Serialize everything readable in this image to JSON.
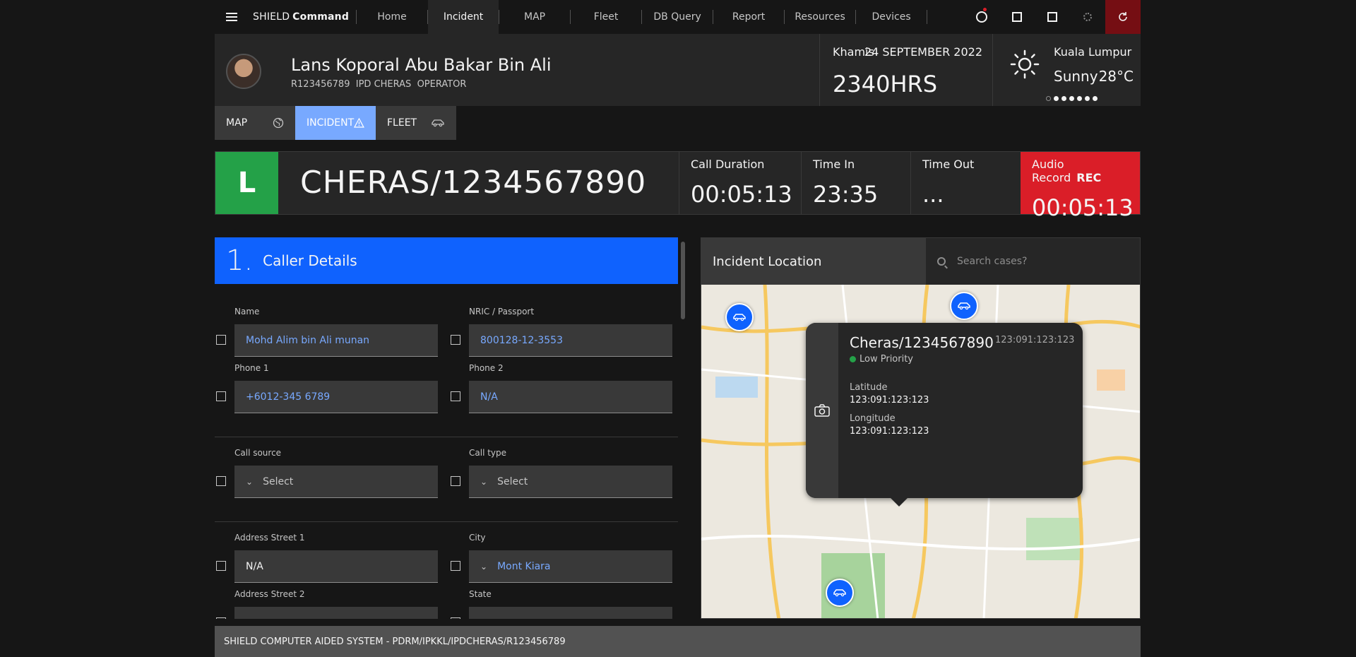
{
  "nav": {
    "brand_main": "SHIELD",
    "brand_bold": "Command",
    "items": [
      {
        "label": "Home"
      },
      {
        "label": "Incident"
      },
      {
        "label": "MAP"
      },
      {
        "label": "Fleet"
      },
      {
        "label": "DB Query"
      },
      {
        "label": "Report"
      },
      {
        "label": "Resources"
      },
      {
        "label": "Devices"
      }
    ],
    "active_item": "Incident",
    "icons": [
      "notification-icon",
      "square-icon",
      "square-icon",
      "settings-icon",
      "refresh-icon"
    ]
  },
  "user": {
    "name": "Lans Koporal Abu Bakar Bin Ali",
    "id": "R123456789",
    "unit": "IPD CHERAS",
    "role": "OPERATOR"
  },
  "datetime": {
    "day": "Khamis",
    "date": "24 SEPTEMBER 2022",
    "time": "2340HRS"
  },
  "weather": {
    "city": "Kuala Lumpur",
    "condition": "Sunny",
    "temp": "28°C"
  },
  "modes": [
    {
      "label": "MAP"
    },
    {
      "label": "INCIDENT"
    },
    {
      "label": "FLEET"
    }
  ],
  "case": {
    "level": "L",
    "id": "CHERAS/1234567890",
    "call_duration_label": "Call Duration",
    "call_duration": "00:05:13",
    "time_in_label": "Time In",
    "time_in": "23:35",
    "time_out_label": "Time Out",
    "time_out": "...",
    "audio_label": "Audio Record",
    "audio_tag": "REC",
    "audio_time": "00:05:13"
  },
  "section": {
    "number": "1.",
    "title": "Caller Details"
  },
  "form": {
    "name_label": "Name",
    "name": "Mohd Alim bin Ali munan",
    "nric_label": "NRIC / Passport",
    "nric": "800128-12-3553",
    "phone1_label": "Phone 1",
    "phone1": "+6012-345 6789",
    "phone2_label": "Phone 2",
    "phone2": "N/A",
    "call_source_label": "Call source",
    "call_source": "Select",
    "call_type_label": "Call type",
    "call_type": "Select",
    "addr1_label": "Address Street 1",
    "addr1": "N/A",
    "city_label": "City",
    "city": "Mont Kiara",
    "addr2_label": "Address Street 2",
    "state_label": "State"
  },
  "map": {
    "title": "Incident Location",
    "search_placeholder": "Search cases?",
    "popup": {
      "title": "Cheras/1234567890",
      "code": "123:091:123:123",
      "priority": "Low Priority",
      "priority_color": "#24a148",
      "lat_label": "Latitude",
      "lat": "123:091:123:123",
      "lon_label": "Longitude",
      "lon": "123:091:123:123"
    }
  },
  "footer": {
    "text": "SHIELD COMPUTER AIDED SYSTEM - PDRM/IPKKL/IPDCHERAS/R123456789"
  },
  "colors": {
    "accent": "#0f62fe",
    "active_tab": "#78a9ff",
    "level_badge": "#24a148",
    "record": "#da1e28"
  }
}
